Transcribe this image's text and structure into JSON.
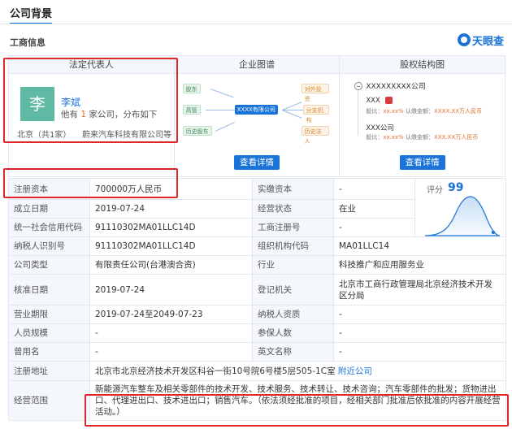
{
  "page_title": "公司背景",
  "section": "工商信息",
  "brand": "天眼查",
  "panels": {
    "legal_rep": {
      "head": "法定代表人",
      "avatar_char": "李",
      "name": "李斌",
      "desc_prefix": "他有",
      "desc_count": "1",
      "desc_suffix": "家公司，分布如下",
      "location": "北京（共1家）",
      "company": "蔚来汽车科技有限公司等"
    },
    "graph": {
      "head": "企业图谱",
      "left_nodes": [
        "股东",
        "高管",
        "历史股东"
      ],
      "center_node": "XXXX有限公司",
      "right_nodes": [
        "对外投资",
        "分支机构",
        "历史法人"
      ],
      "button": "查看详情"
    },
    "equity": {
      "head": "股权结构图",
      "root": "XXXXXXXXX公司",
      "holders": [
        {
          "name": "XXX",
          "ratio_label": "股比：",
          "ratio": "xx.xx%",
          "amount_label": "认缴金额：",
          "amount": "XXXX.XX万人民币"
        },
        {
          "name": "XXX公司",
          "ratio_label": "股比：",
          "ratio": "xx.xx%",
          "amount_label": "认缴金额：",
          "amount": "XXX.XX万人民币"
        }
      ],
      "button": "查看详情"
    }
  },
  "table": {
    "registered_capital_label": "注册资本",
    "registered_capital": "700000万人民币",
    "paid_capital_label": "实缴资本",
    "paid_capital": "-",
    "score_label": "评分",
    "score": "99",
    "established_label": "成立日期",
    "established": "2019-07-24",
    "status_label": "经营状态",
    "status": "在业",
    "credit_code_label": "统一社会信用代码",
    "credit_code": "91110302MA01LLC14D",
    "biz_reg_label": "工商注册号",
    "biz_reg": "-",
    "taxpayer_label": "纳税人识别号",
    "taxpayer": "91110302MA01LLC14D",
    "org_code_label": "组织机构代码",
    "org_code": "MA01LLC14",
    "company_type_label": "公司类型",
    "company_type": "有限责任公司(台港澳合资)",
    "industry_label": "行业",
    "industry": "科技推广和应用服务业",
    "approval_label": "核准日期",
    "approval": "2019-07-24",
    "authority_label": "登记机关",
    "authority": "北京市工商行政管理局北京经济技术开发区分局",
    "term_label": "营业期限",
    "term": "2019-07-24至2049-07-23",
    "tax_qual_label": "纳税人资质",
    "tax_qual": "-",
    "staff_label": "人员规模",
    "staff": "-",
    "insured_label": "参保人数",
    "insured": "-",
    "former_name_label": "曾用名",
    "former_name": "-",
    "english_name_label": "英文名称",
    "english_name": "-",
    "address_label": "注册地址",
    "address": "北京市北京经济技术开发区科谷一街10号院6号楼5层505-1C室",
    "nearby_link": "附近公司",
    "scope_label": "经营范围",
    "scope": "新能源汽车整车及相关零部件的技术开发、技术服务、技术转让、技术咨询；汽车零部件的批发；货物进出口、代理进出口、技术进出口；销售汽车。（依法须经批准的项目，经相关部门批准后依批准的内容开展经营活动。）"
  },
  "colors": {
    "accent": "#1a73d9",
    "highlight_box": "#e0262b",
    "avatar_bg": "#5fb9a3",
    "orange": "#e0712c"
  }
}
